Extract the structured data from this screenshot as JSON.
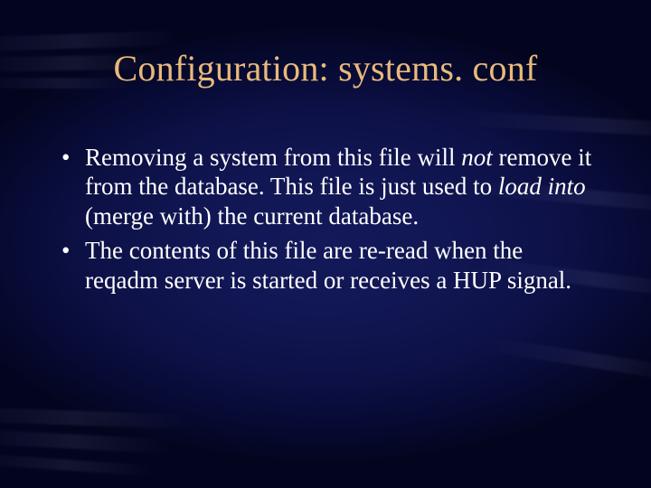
{
  "slide": {
    "title": "Configuration: systems. conf",
    "bullets": [
      {
        "pre": "Removing a system from this file will ",
        "em1": "not",
        "mid": " remove it from the database.  This file is just used to ",
        "em2": "load into",
        "post": " (merge with) the current database."
      },
      {
        "pre": "The contents of this file are re-read when the reqadm server is started or receives a HUP signal.",
        "em1": "",
        "mid": "",
        "em2": "",
        "post": ""
      }
    ]
  }
}
